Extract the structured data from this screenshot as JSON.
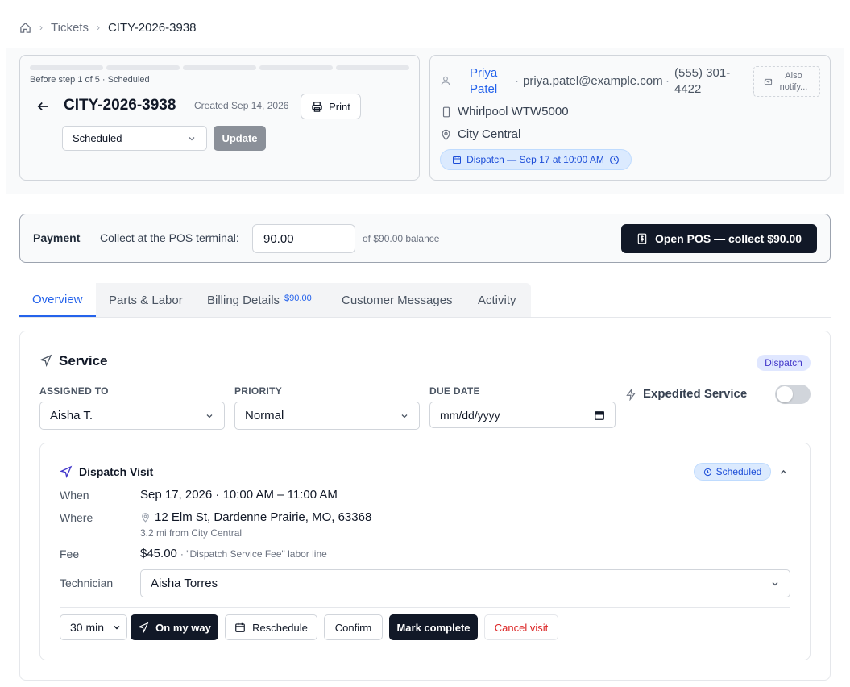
{
  "breadcrumb": {
    "items": [
      "Tickets",
      "CITY-2026-3938"
    ]
  },
  "header": {
    "step_text": "Before step 1 of 5 · Scheduled",
    "ticket_id": "CITY-2026-3938",
    "created": "Created Sep 14, 2026",
    "print_label": "Print",
    "status_value": "Scheduled",
    "update_label": "Update"
  },
  "customer": {
    "name": "Priya Patel",
    "email": "priya.patel@example.com",
    "phone": "(555) 301-4422",
    "also_notify": "Also notify...",
    "appliance": "Whirlpool WTW5000",
    "location": "City Central",
    "dispatch_pill": "Dispatch — Sep 17 at 10:00 AM"
  },
  "payment": {
    "label": "Payment",
    "collect_label": "Collect at the POS terminal:",
    "amount_value": "90.00",
    "balance_text": "of $90.00 balance",
    "pos_button": "Open POS — collect $90.00"
  },
  "tabs": [
    {
      "label": "Overview",
      "active": true
    },
    {
      "label": "Parts & Labor"
    },
    {
      "label": "Billing Details",
      "badge": "$90.00"
    },
    {
      "label": "Customer Messages"
    },
    {
      "label": "Activity"
    }
  ],
  "service": {
    "title": "Service",
    "badge": "Dispatch",
    "assigned_label": "ASSIGNED TO",
    "assigned_value": "Aisha T.",
    "priority_label": "PRIORITY",
    "priority_value": "Normal",
    "due_label": "DUE DATE",
    "due_placeholder": "mm/dd/yyyy",
    "expedited_label": "Expedited Service",
    "expedited_on": false
  },
  "visit": {
    "title": "Dispatch Visit",
    "status": "Scheduled",
    "when_label": "When",
    "when_value": "Sep 17, 2026 · 10:00 AM – 11:00 AM",
    "where_label": "Where",
    "where_value": "12 Elm St, Dardenne Prairie, MO, 63368",
    "where_sub": "3.2 mi from City Central",
    "fee_label": "Fee",
    "fee_value": "$45.00",
    "fee_note": "· \"Dispatch Service Fee\" labor line",
    "tech_label": "Technician",
    "tech_value": "Aisha Torres",
    "eta_value": "30 min",
    "actions": {
      "on_my_way": "On my way",
      "reschedule": "Reschedule",
      "confirm": "Confirm",
      "mark_complete": "Mark complete",
      "cancel": "Cancel visit"
    }
  },
  "colors": {
    "accent": "#2563eb",
    "dark": "#111827",
    "danger": "#dc2626"
  }
}
